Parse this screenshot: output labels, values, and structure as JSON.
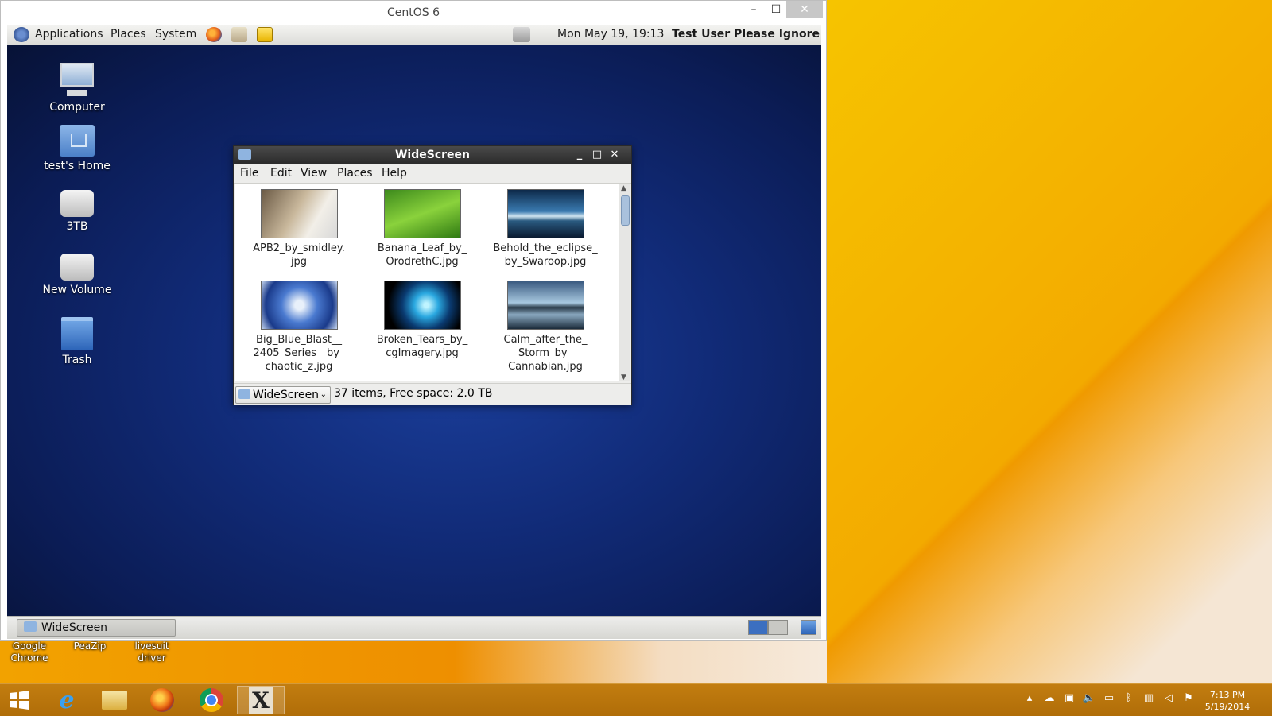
{
  "windows_shortcuts": [
    {
      "label": "Google Chrome"
    },
    {
      "label": "PeaZip"
    },
    {
      "label": "livesuit driver"
    }
  ],
  "vm_window": {
    "title": "CentOS 6",
    "controls": {
      "minimize": "–",
      "maximize": "☐",
      "close": "✕"
    }
  },
  "gnome_panel": {
    "menus": [
      "Applications",
      "Places",
      "System"
    ],
    "clock": "Mon May 19, 19:13",
    "user": "Test User Please Ignore"
  },
  "desktop_icons": [
    {
      "label": "Computer",
      "icon": "computer-icon"
    },
    {
      "label": "test's Home",
      "icon": "home-folder-icon"
    },
    {
      "label": "3TB",
      "icon": "drive-icon"
    },
    {
      "label": "New Volume",
      "icon": "drive-icon"
    },
    {
      "label": "Trash",
      "icon": "trash-icon"
    }
  ],
  "file_manager": {
    "title": "WideScreen",
    "menu": [
      "File",
      "Edit",
      "View",
      "Places",
      "Help"
    ],
    "files": [
      {
        "name": "APB2_by_smidley.\njpg"
      },
      {
        "name": "Banana_Leaf_by_\nOrodrethC.jpg"
      },
      {
        "name": "Behold_the_eclipse_\nby_Swaroop.jpg"
      },
      {
        "name": "Big_Blue_Blast__\n2405_Series__by_\nchaotic_z.jpg"
      },
      {
        "name": "Broken_Tears_by_\ncgImagery.jpg"
      },
      {
        "name": "Calm_after_the_\nStorm_by_\nCannabian.jpg"
      }
    ],
    "location": "WideScreen",
    "status": "37 items, Free space: 2.0 TB"
  },
  "gnome_bottom": {
    "task_label": "WideScreen"
  },
  "taskbar": {
    "clock_time": "7:13 PM",
    "clock_date": "5/19/2014"
  },
  "colors": {
    "gnome_desktop": "#112b78",
    "taskbar": "#b87510",
    "titlebar": "#2b2b2b"
  }
}
